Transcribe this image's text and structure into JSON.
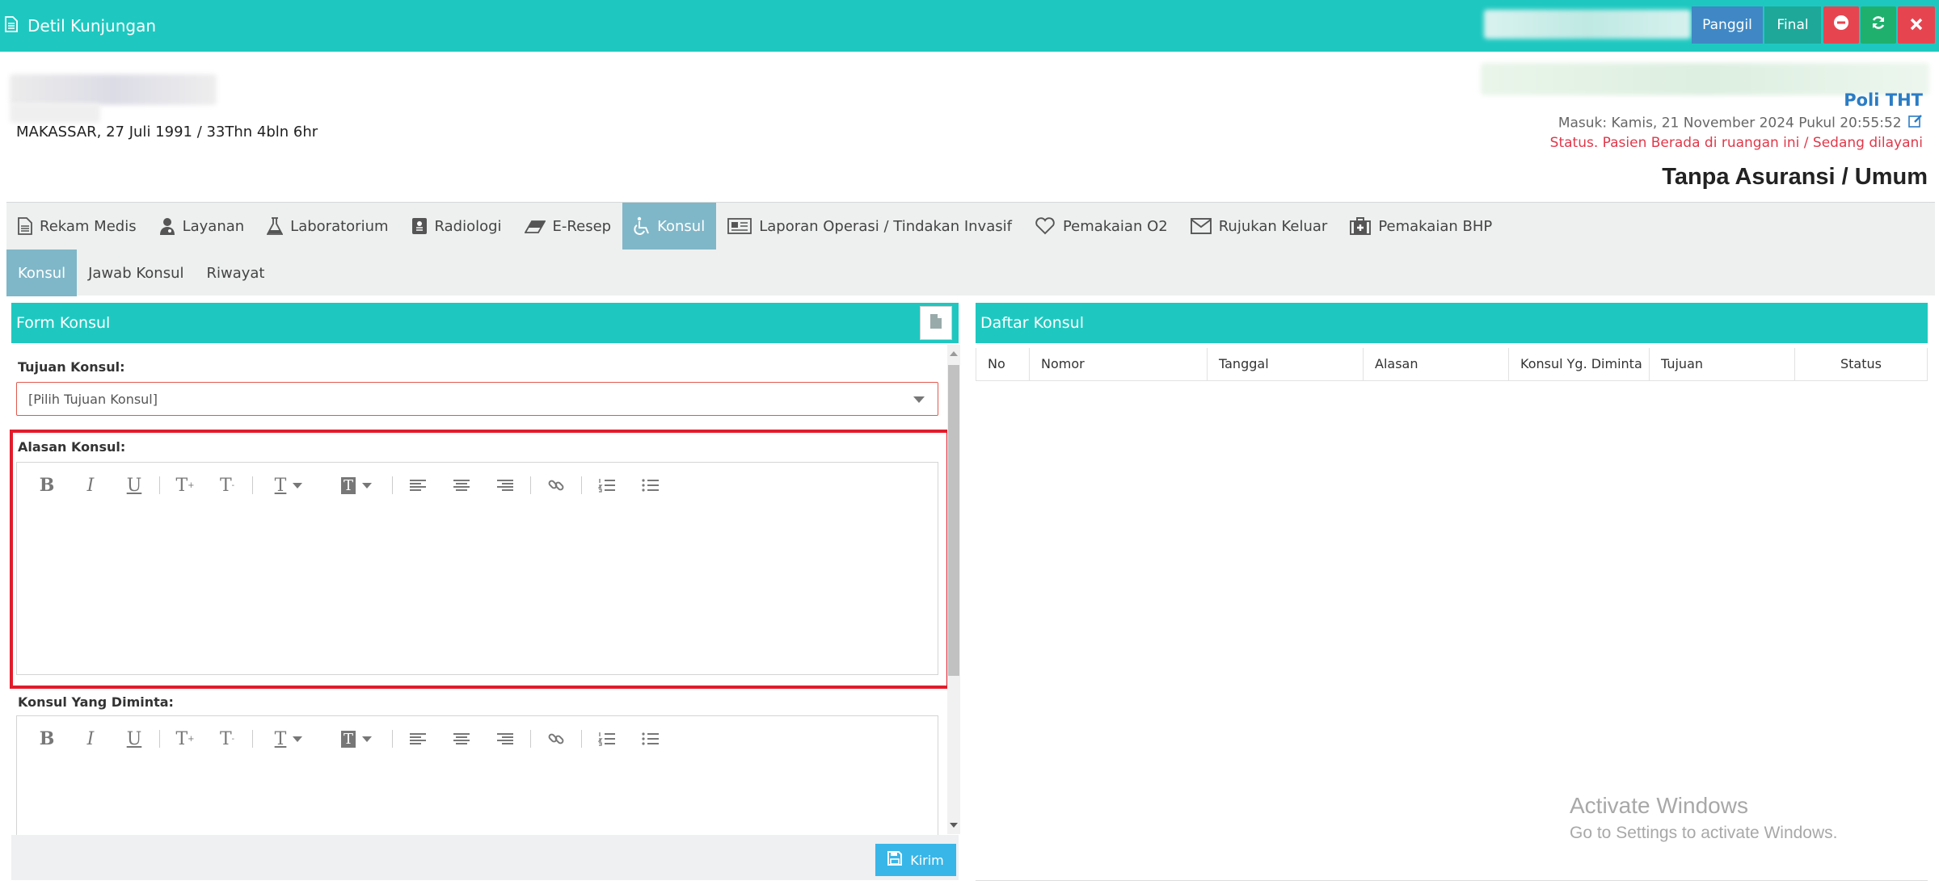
{
  "header": {
    "title": "Detil Kunjungan",
    "buttons": {
      "panggil": "Panggil",
      "final": "Final"
    },
    "icons": {
      "minus": "minus-circle-icon",
      "refresh": "refresh-icon",
      "close": "close-icon"
    }
  },
  "patient": {
    "birth_info": "MAKASSAR, 27 Juli 1991 / 33Thn 4bln 6hr",
    "poli": "Poli THT",
    "masuk": "Masuk: Kamis, 21 November 2024 Pukul 20:55:52",
    "status": "Status. Pasien Berada di ruangan ini / Sedang dilayani",
    "insurance": "Tanpa Asuransi / Umum"
  },
  "tabs": [
    {
      "label": "Rekam Medis",
      "icon": "document-icon"
    },
    {
      "label": "Layanan",
      "icon": "doctor-icon"
    },
    {
      "label": "Laboratorium",
      "icon": "flask-icon"
    },
    {
      "label": "Radiologi",
      "icon": "xray-icon"
    },
    {
      "label": "E-Resep",
      "icon": "eraser-icon"
    },
    {
      "label": "Konsul",
      "icon": "wheelchair-icon"
    },
    {
      "label": "Laporan Operasi / Tindakan Invasif",
      "icon": "newspaper-icon"
    },
    {
      "label": "Pemakaian O2",
      "icon": "heart-icon"
    },
    {
      "label": "Rujukan Keluar",
      "icon": "envelope-icon"
    },
    {
      "label": "Pemakaian BHP",
      "icon": "medkit-icon"
    }
  ],
  "subtabs": [
    "Konsul",
    "Jawab Konsul",
    "Riwayat"
  ],
  "form": {
    "title": "Form Konsul",
    "tujuan_label": "Tujuan Konsul:",
    "tujuan_value": "[Pilih Tujuan Konsul]",
    "alasan_label": "Alasan Konsul:",
    "konsul_diminta_label": "Konsul Yang Diminta:",
    "submit_label": "Kirim"
  },
  "daftar": {
    "title": "Daftar Konsul",
    "columns": [
      "No",
      "Nomor",
      "Tanggal",
      "Alasan",
      "Konsul Yg. Diminta",
      "Tujuan",
      "Status"
    ]
  },
  "watermark": {
    "line1": "Activate Windows",
    "line2": "Go to Settings to activate Windows."
  },
  "colors": {
    "header": "#1ec8c0",
    "active_tab": "#7fb7c8",
    "panggil": "#3f88c5",
    "final": "#1ea89a",
    "danger": "#e64550",
    "success": "#1fb06d",
    "highlight_border": "#e11b2b",
    "kirim": "#38b6e8"
  }
}
